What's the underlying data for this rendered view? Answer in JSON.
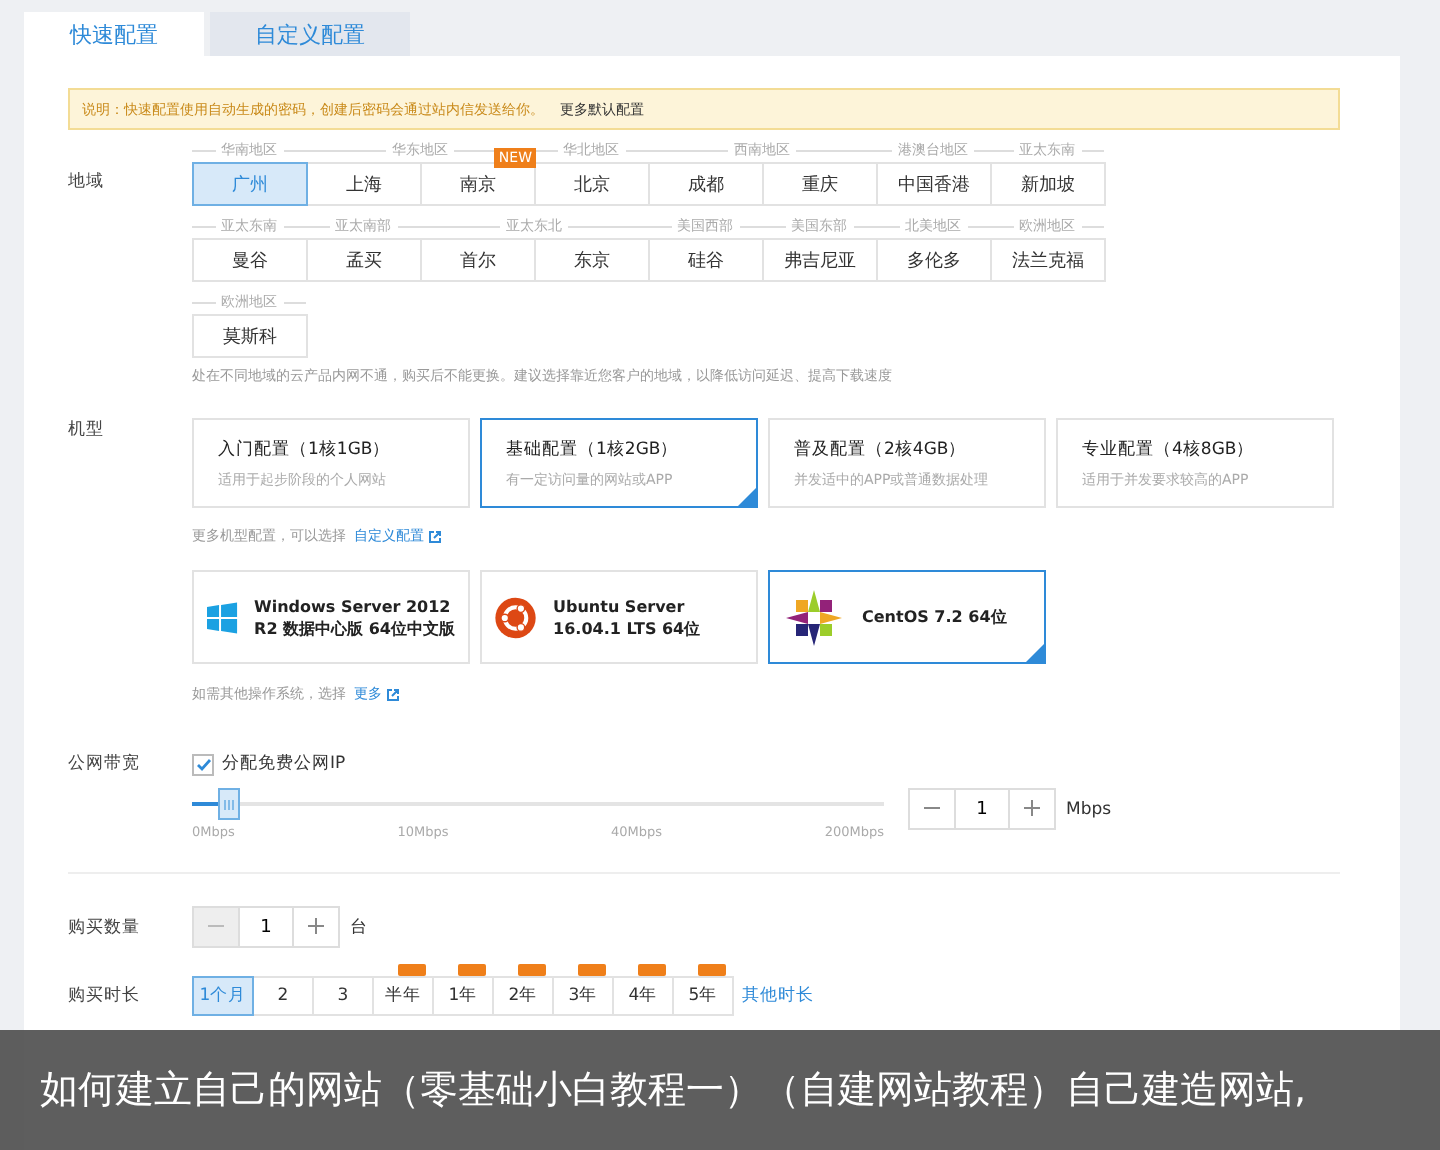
{
  "tabs": [
    {
      "label": "快速配置",
      "selected": true
    },
    {
      "label": "自定义配置",
      "selected": false
    }
  ],
  "notice": {
    "text": "说明：快速配置使用自动生成的密码，创建后密码会通过站内信发送给你。",
    "link": "更多默认配置"
  },
  "region": {
    "label": "地域",
    "lines": [
      {
        "groups": [
          {
            "group": "华南地区",
            "cities": [
              {
                "name": "广州",
                "selected": true
              }
            ]
          },
          {
            "group": "华东地区",
            "cities": [
              {
                "name": "上海",
                "selected": false
              },
              {
                "name": "南京",
                "selected": false,
                "badge": "NEW"
              }
            ]
          },
          {
            "group": "华北地区",
            "cities": [
              {
                "name": "北京",
                "selected": false
              }
            ]
          },
          {
            "group": "西南地区",
            "cities": [
              {
                "name": "成都",
                "selected": false
              },
              {
                "name": "重庆",
                "selected": false
              }
            ]
          },
          {
            "group": "港澳台地区",
            "cities": [
              {
                "name": "中国香港",
                "selected": false
              }
            ]
          },
          {
            "group": "亚太东南",
            "cities": [
              {
                "name": "新加坡",
                "selected": false
              }
            ]
          }
        ]
      },
      {
        "groups": [
          {
            "group": "亚太东南",
            "cities": [
              {
                "name": "曼谷",
                "selected": false
              }
            ]
          },
          {
            "group": "亚太南部",
            "cities": [
              {
                "name": "孟买",
                "selected": false
              }
            ]
          },
          {
            "group": "亚太东北",
            "cities": [
              {
                "name": "首尔",
                "selected": false
              },
              {
                "name": "东京",
                "selected": false
              }
            ]
          },
          {
            "group": "美国西部",
            "cities": [
              {
                "name": "硅谷",
                "selected": false
              }
            ]
          },
          {
            "group": "美国东部",
            "cities": [
              {
                "name": "弗吉尼亚",
                "selected": false
              }
            ]
          },
          {
            "group": "北美地区",
            "cities": [
              {
                "name": "多伦多",
                "selected": false
              }
            ]
          },
          {
            "group": "欧洲地区",
            "cities": [
              {
                "name": "法兰克福",
                "selected": false
              }
            ]
          }
        ]
      },
      {
        "groups": [
          {
            "group": "欧洲地区",
            "cities": [
              {
                "name": "莫斯科",
                "selected": false
              }
            ]
          }
        ]
      }
    ],
    "hint": "处在不同地域的云产品内网不通，购买后不能更换。建议选择靠近您客户的地域，以降低访问延迟、提高下载速度"
  },
  "instance": {
    "label": "机型",
    "options": [
      {
        "title": "入门配置（1核1GB）",
        "desc": "适用于起步阶段的个人网站",
        "selected": false
      },
      {
        "title": "基础配置（1核2GB）",
        "desc": "有一定访问量的网站或APP",
        "selected": true
      },
      {
        "title": "普及配置（2核4GB）",
        "desc": "并发适中的APP或普通数据处理",
        "selected": false
      },
      {
        "title": "专业配置（4核8GB）",
        "desc": "适用于并发要求较高的APP",
        "selected": false
      }
    ],
    "hint": "更多机型配置，可以选择",
    "link": "自定义配置"
  },
  "os": {
    "options": [
      {
        "kind": "windows",
        "name": "Windows Server 2012 R2 数据中心版 64位中文版",
        "selected": false
      },
      {
        "kind": "ubuntu",
        "name": "Ubuntu Server 16.04.1 LTS 64位",
        "selected": false
      },
      {
        "kind": "centos",
        "name": "CentOS 7.2 64位",
        "selected": true
      }
    ],
    "hint": "如需其他操作系统，选择",
    "link": "更多"
  },
  "bandwidth": {
    "label": "公网带宽",
    "checkbox": {
      "label": "分配免费公网IP",
      "checked": true
    },
    "slider": {
      "level": 0.04,
      "ticks": [
        "0Mbps",
        "10Mbps",
        "40Mbps",
        "200Mbps"
      ]
    },
    "stepper": {
      "value": "1",
      "unit": "Mbps"
    }
  },
  "quantity": {
    "label": "购买数量",
    "value": "1",
    "unit": "台",
    "minus_disabled": true
  },
  "duration": {
    "label": "购买时长",
    "options": [
      {
        "label": "1个月",
        "selected": true,
        "tag": false
      },
      {
        "label": "2",
        "selected": false,
        "tag": false
      },
      {
        "label": "3",
        "selected": false,
        "tag": false
      },
      {
        "label": "半年",
        "selected": false,
        "tag": true
      },
      {
        "label": "1年",
        "selected": false,
        "tag": true
      },
      {
        "label": "2年",
        "selected": false,
        "tag": true
      },
      {
        "label": "3年",
        "selected": false,
        "tag": true
      },
      {
        "label": "4年",
        "selected": false,
        "tag": true
      },
      {
        "label": "5年",
        "selected": false,
        "tag": true
      }
    ],
    "link": "其他时长"
  },
  "caption": "如何建立自己的网站（零基础小白教程一）（自建网站教程）自己建造网站,"
}
